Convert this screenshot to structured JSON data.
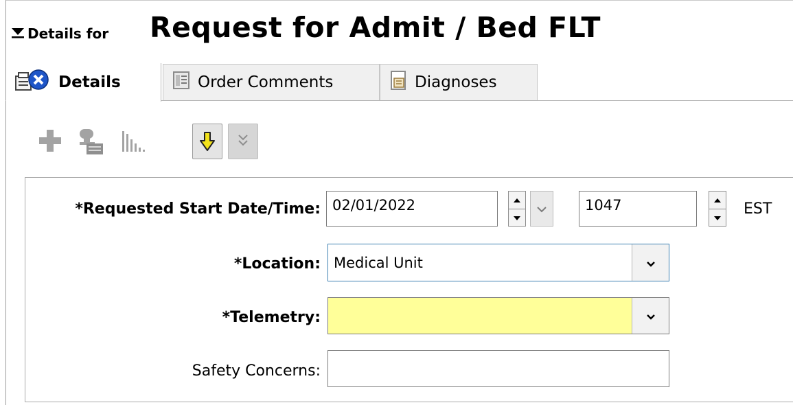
{
  "header": {
    "prefix": "Details for",
    "title": "Request for Admit / Bed FLT"
  },
  "tabs": [
    {
      "label": "Details",
      "icon": "details-error-icon",
      "active": true
    },
    {
      "label": "Order Comments",
      "icon": "comments-icon",
      "active": false
    },
    {
      "label": "Diagnoses",
      "icon": "diagnoses-icon",
      "active": false
    }
  ],
  "toolbar": {
    "icons": [
      "add-icon",
      "stamp-icon",
      "bar-chart-icon",
      "next-required-icon",
      "expand-all-icon"
    ]
  },
  "form": {
    "start": {
      "label": "*Requested Start Date/Time:",
      "date": "02/01/2022",
      "time": "1047",
      "timezone": "EST"
    },
    "location": {
      "label": "*Location:",
      "value": "Medical Unit"
    },
    "telemetry": {
      "label": "*Telemetry:",
      "value": "",
      "highlight": "#ffff99"
    },
    "safety": {
      "label": "Safety Concerns:",
      "value": ""
    }
  },
  "colors": {
    "required_highlight": "#ffff99",
    "focus_border": "#3c7fb1",
    "error_icon": "#1e55c8",
    "arrow_yellow": "#f2e21a"
  }
}
